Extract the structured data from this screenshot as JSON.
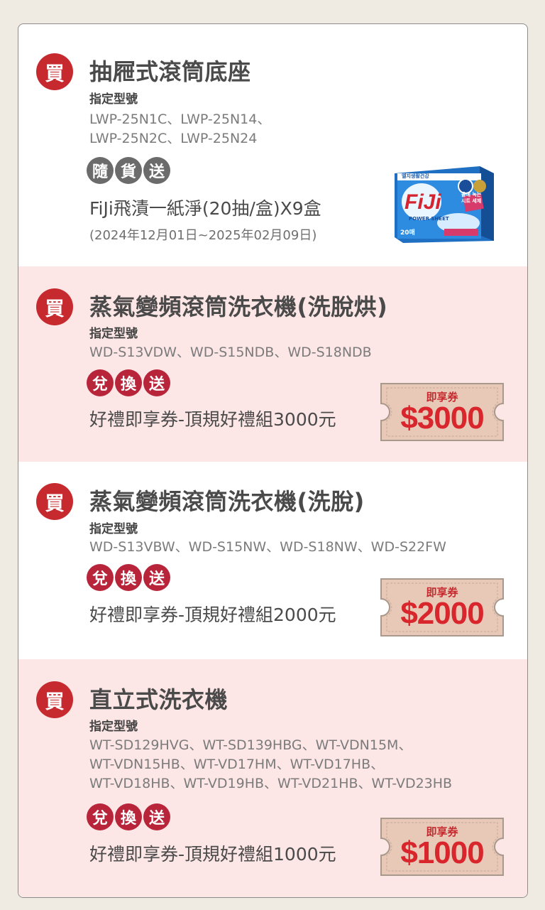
{
  "buy_icon_text": "買",
  "model_label": "指定型號",
  "sections": [
    {
      "title": "抽屜式滾筒底座",
      "models": [
        "LWP-25N1C、LWP-25N14、",
        "LWP-25N2C、LWP-25N24"
      ],
      "badge": [
        "隨",
        "貨",
        "送"
      ],
      "gift": "FiJi飛漬一紙淨(20抽/盒)X9盒",
      "period": "(2024年12月01日~2025年02月09日)",
      "product_text": {
        "brand": "FiJi",
        "top": "엘지생활건강",
        "sub": "POWER SHEET",
        "count": "20매",
        "tag": "올에 녹는 시트 세제"
      }
    },
    {
      "title": "蒸氣變頻滾筒洗衣機(洗脫烘)",
      "models": [
        "WD-S13VDW、WD-S15NDB、WD-S18NDB"
      ],
      "badge": [
        "兌",
        "換",
        "送"
      ],
      "gift": "好禮即享券-頂規好禮組3000元",
      "coupon": {
        "label": "即享券",
        "amount": "$3000"
      }
    },
    {
      "title": "蒸氣變頻滾筒洗衣機(洗脫)",
      "models": [
        "WD-S13VBW、WD-S15NW、WD-S18NW、WD-S22FW"
      ],
      "badge": [
        "兌",
        "換",
        "送"
      ],
      "gift": "好禮即享券-頂規好禮組2000元",
      "coupon": {
        "label": "即享券",
        "amount": "$2000"
      }
    },
    {
      "title": "直立式洗衣機",
      "models": [
        "WT-SD129HVG、WT-SD139HBG、WT-VDN15M、",
        "WT-VDN15HB、WT-VD17HM、WT-VD17HB、",
        "WT-VD18HB、WT-VD19HB、WT-VD21HB、WT-VD23HB"
      ],
      "badge": [
        "兌",
        "換",
        "送"
      ],
      "gift": "好禮即享券-頂規好禮組1000元",
      "coupon": {
        "label": "即享券",
        "amount": "$1000"
      }
    }
  ],
  "colors": {
    "page_bg": "#efebe3",
    "pink_bg": "#fde6e6",
    "buy_red": "#c62a2f",
    "badge_gray": "#6b6b6b",
    "badge_red": "#b8253a",
    "coupon_bg": "#e8c9b8",
    "coupon_amount": "#d8262c"
  }
}
